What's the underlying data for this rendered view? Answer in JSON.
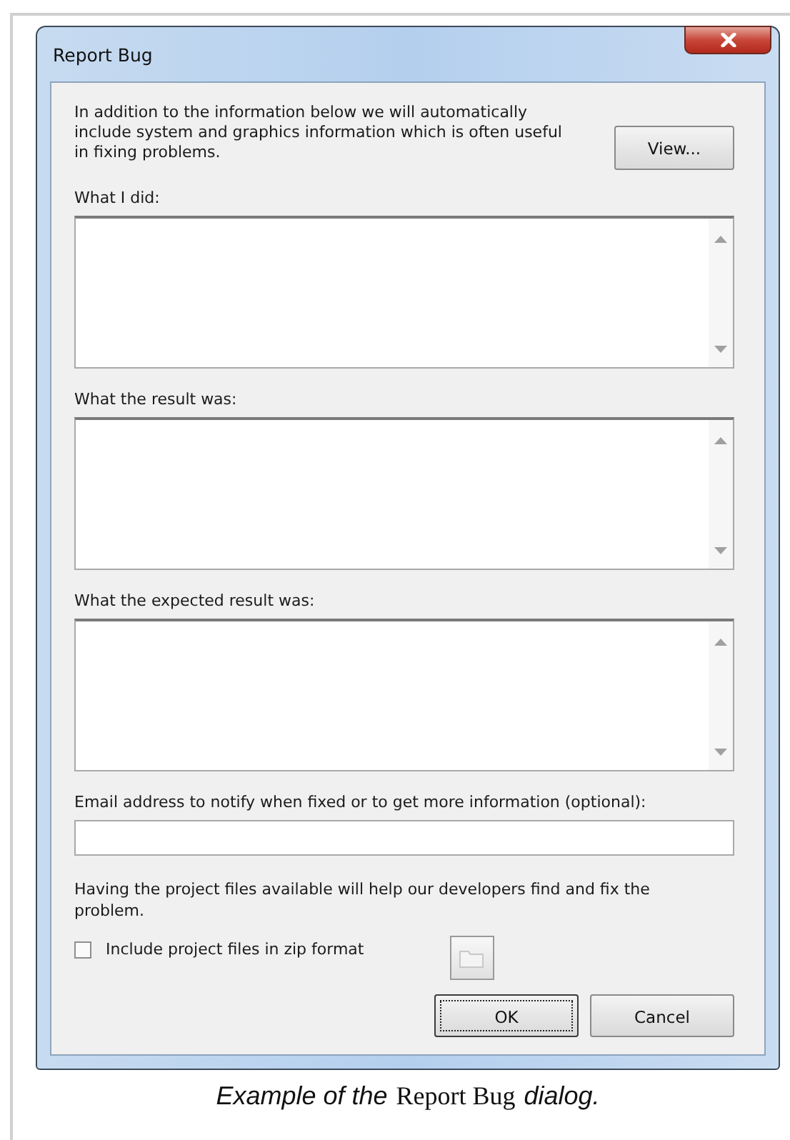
{
  "window": {
    "title": "Report Bug"
  },
  "intro": "In addition to the information below we will automatically include system and graphics information which is often useful in fixing problems.",
  "view_button": "View...",
  "fields": [
    {
      "label": "What I did:",
      "kind": "multiline"
    },
    {
      "label": "What the result was:",
      "kind": "multiline"
    },
    {
      "label": "What the expected result was:",
      "kind": "multiline"
    },
    {
      "label": "Email address to notify when fixed or to get more information (optional):",
      "kind": "single"
    }
  ],
  "note": "Having the project files available will help our developers find and fix the problem.",
  "include_checkbox": {
    "label": "Include project files in zip format",
    "checked": false
  },
  "buttons": [
    {
      "label": "OK",
      "focused": true
    },
    {
      "label": "Cancel",
      "focused": false
    }
  ],
  "caption": [
    {
      "text": "Example of the",
      "kind": "emphasis"
    },
    {
      "text": "Report Bug",
      "kind": "name"
    },
    {
      "text": "dialog.",
      "kind": "emphasis"
    }
  ]
}
